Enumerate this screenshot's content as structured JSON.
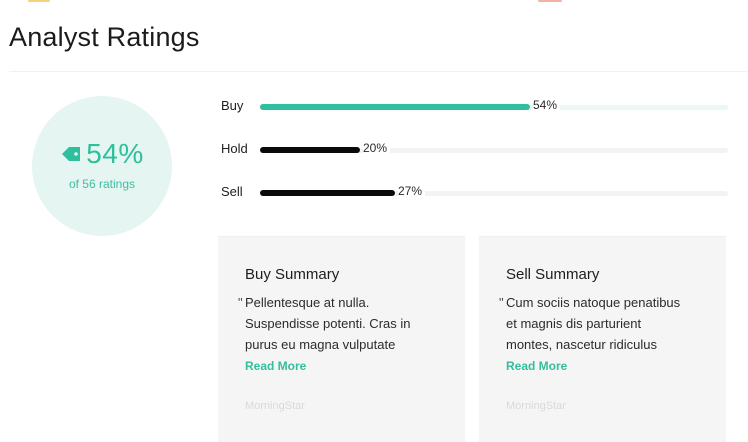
{
  "colors": {
    "accent": "#2fbf9d",
    "accent_light": "#e5f5f1",
    "bar_dark": "#0a0a0a",
    "track": "#f3f3f3",
    "buy_track": "#eaf7f3",
    "card_bg": "#f5f5f5"
  },
  "header": {
    "title": "Analyst Ratings"
  },
  "summary": {
    "percent": "54%",
    "subtitle": "of 56 ratings",
    "icon": "tag-icon"
  },
  "ratings": [
    {
      "label": "Buy",
      "percent_label": "54%",
      "value": 54
    },
    {
      "label": "Hold",
      "percent_label": "20%",
      "value": 20
    },
    {
      "label": "Sell",
      "percent_label": "27%",
      "value": 27
    }
  ],
  "cards": [
    {
      "title": "Buy Summary",
      "quote_mark": "\"",
      "quote_lines": [
        "Pellentesque at nulla.",
        "Suspendisse potenti. Cras in",
        "purus eu magna vulputate"
      ],
      "link": "Read More",
      "source": "MorningStar"
    },
    {
      "title": "Sell Summary",
      "quote_mark": "\"",
      "quote_lines": [
        "Cum sociis natoque penatibus",
        "et magnis dis parturient",
        "montes, nascetur ridiculus"
      ],
      "link": "Read More",
      "source": "MorningStar"
    }
  ]
}
